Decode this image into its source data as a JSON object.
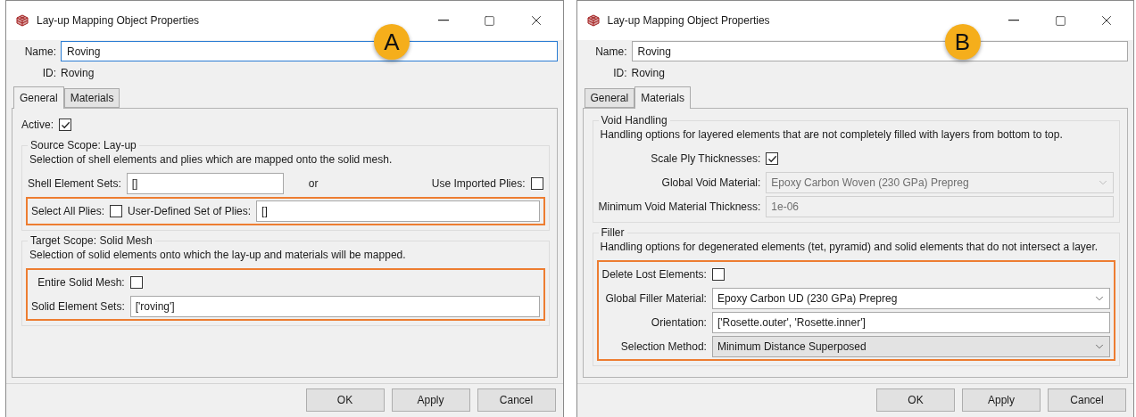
{
  "dialogs": [
    {
      "title": "Lay-up Mapping Object Properties",
      "badge": "A",
      "name": {
        "label": "Name:",
        "value": "Roving",
        "focused": true
      },
      "id": {
        "label": "ID:",
        "value": "Roving"
      },
      "tabs": [
        {
          "label": "General",
          "selected": true
        },
        {
          "label": "Materials",
          "selected": false
        }
      ],
      "content": [
        {
          "kind": "row",
          "left": [
            {
              "kind": "label",
              "text": "Active:"
            },
            {
              "kind": "checkbox",
              "checked": true
            }
          ]
        },
        {
          "kind": "group",
          "title": "Source Scope: Lay-up",
          "description": "Selection of shell elements and plies which are mapped onto the solid mesh.",
          "rows": [
            {
              "kind": "row",
              "left": [
                {
                  "kind": "label",
                  "text": "Shell Element Sets:"
                },
                {
                  "kind": "field",
                  "value": "[]"
                },
                {
                  "kind": "label",
                  "text": "or"
                }
              ],
              "right": [
                {
                  "kind": "label",
                  "text": "Use Imported Plies:"
                },
                {
                  "kind": "checkbox",
                  "checked": false
                }
              ]
            },
            {
              "kind": "highlight",
              "rows": [
                {
                  "kind": "row",
                  "left": [
                    {
                      "kind": "label",
                      "text": "Select All Plies:"
                    },
                    {
                      "kind": "checkbox",
                      "checked": false
                    }
                  ],
                  "right": [
                    {
                      "kind": "label",
                      "text": "User-Defined Set of Plies:"
                    },
                    {
                      "kind": "field",
                      "value": "[]"
                    }
                  ]
                }
              ]
            }
          ]
        },
        {
          "kind": "form_group",
          "title": "Target Scope: Solid Mesh",
          "description": "Selection of solid elements onto which the lay-up and materials will be mapped.",
          "rows": [
            {
              "kind": "highlight",
              "rows": [
                {
                  "kind": "row",
                  "label": "Entire Solid Mesh:",
                  "control": {
                    "kind": "checkbox",
                    "checked": false
                  }
                },
                {
                  "kind": "row",
                  "label": "Solid Element Sets:",
                  "control": {
                    "kind": "field",
                    "value": "['roving']"
                  }
                }
              ]
            }
          ]
        }
      ],
      "buttons": [
        "OK",
        "Apply",
        "Cancel"
      ]
    },
    {
      "title": "Lay-up Mapping Object Properties",
      "badge": "B",
      "name": {
        "label": "Name:",
        "value": "Roving",
        "focused": false
      },
      "id": {
        "label": "ID:",
        "value": "Roving"
      },
      "tabs": [
        {
          "label": "General",
          "selected": false
        },
        {
          "label": "Materials",
          "selected": true
        }
      ],
      "content": [
        {
          "kind": "form_group",
          "title": "Void Handling",
          "description": "Handling options for layered elements that are not completely filled with layers from bottom to top.",
          "rows": [
            {
              "kind": "row",
              "label": "Scale Ply Thicknesses:",
              "control": {
                "kind": "checkbox",
                "checked": true
              }
            },
            {
              "kind": "row",
              "label": "Global Void Material:",
              "control": {
                "kind": "combo",
                "value": "Epoxy Carbon Woven (230 GPa) Prepreg",
                "disabled": true
              }
            },
            {
              "kind": "row",
              "label": "Minimum Void Material Thickness:",
              "control": {
                "kind": "field",
                "value": "1e-06",
                "disabled": true
              }
            }
          ]
        },
        {
          "kind": "form_group",
          "title": "Filler",
          "description": "Handling options for degenerated elements (tet, pyramid) and solid elements that do not intersect a layer.",
          "rows": [
            {
              "kind": "highlight",
              "rows": [
                {
                  "kind": "row",
                  "label": "Delete Lost Elements:",
                  "control": {
                    "kind": "checkbox",
                    "checked": false
                  }
                },
                {
                  "kind": "row",
                  "label": "Global Filler Material:",
                  "control": {
                    "kind": "combo",
                    "value": "Epoxy Carbon UD (230 GPa) Prepreg",
                    "disabled": false
                  }
                },
                {
                  "kind": "row",
                  "label": "Orientation:",
                  "control": {
                    "kind": "field",
                    "value": "['Rosette.outer', 'Rosette.inner']",
                    "disabled": false
                  }
                },
                {
                  "kind": "row",
                  "label": "Selection Method:",
                  "control": {
                    "kind": "dropdown",
                    "value": "Minimum Distance Superposed",
                    "disabled": false
                  }
                }
              ]
            }
          ]
        }
      ],
      "buttons": [
        "OK",
        "Apply",
        "Cancel"
      ]
    }
  ]
}
